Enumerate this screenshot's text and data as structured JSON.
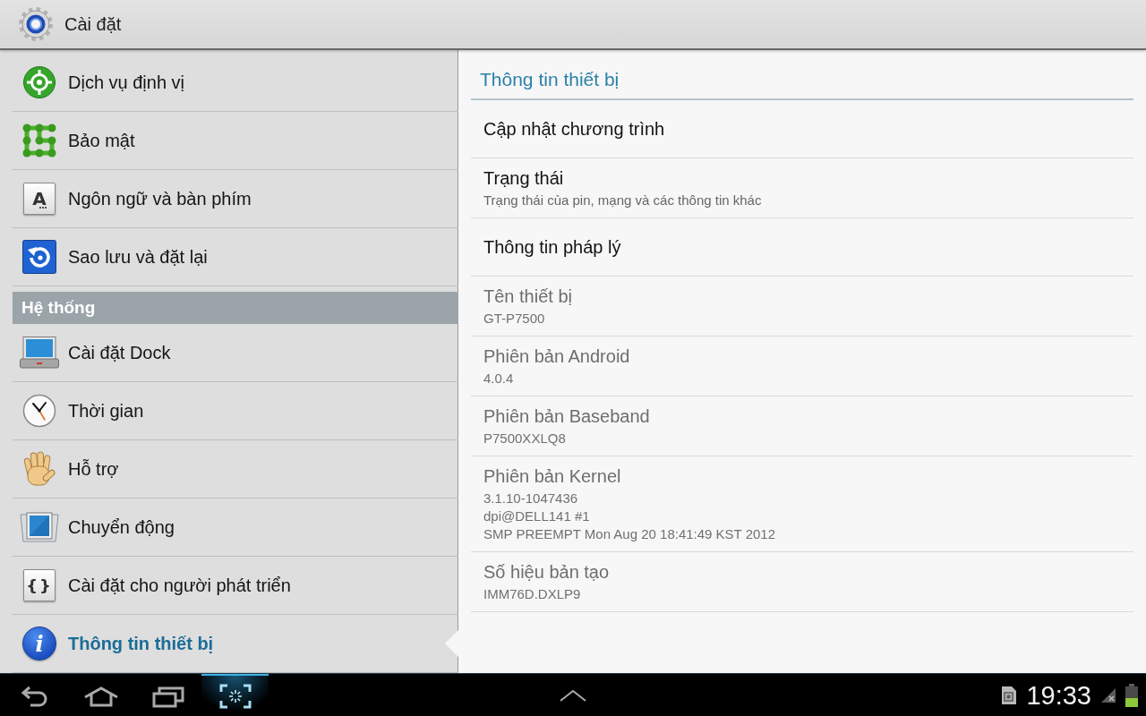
{
  "action_bar": {
    "title": "Cài đặt"
  },
  "sidebar": {
    "items": [
      {
        "kind": "setting",
        "label": "Dịch vụ định vị",
        "selected": false
      },
      {
        "kind": "setting",
        "label": "Bảo mật",
        "selected": false
      },
      {
        "kind": "setting",
        "label": "Ngôn ngữ và bàn phím",
        "selected": false,
        "icon_glyph": "A"
      },
      {
        "kind": "setting",
        "label": "Sao lưu và đặt lại",
        "selected": false
      },
      {
        "kind": "header",
        "label": "Hệ thống"
      },
      {
        "kind": "setting",
        "label": "Cài đặt Dock",
        "selected": false
      },
      {
        "kind": "setting",
        "label": "Thời gian",
        "selected": false
      },
      {
        "kind": "setting",
        "label": "Hỗ trợ",
        "selected": false
      },
      {
        "kind": "setting",
        "label": "Chuyển động",
        "selected": false
      },
      {
        "kind": "setting",
        "label": "Cài đặt cho người phát triển",
        "selected": false,
        "icon_glyph": "{}"
      },
      {
        "kind": "setting",
        "label": "Thông tin thiết bị",
        "selected": true,
        "icon_glyph": "i"
      }
    ]
  },
  "detail": {
    "title": "Thông tin thiết bị",
    "items": [
      {
        "title": "Cập nhật chương trình",
        "disabled": false
      },
      {
        "title": "Trạng thái",
        "summary": "Trạng thái của pin, mạng và các thông tin khác",
        "disabled": false
      },
      {
        "title": "Thông tin pháp lý",
        "disabled": false
      },
      {
        "title": "Tên thiết bị",
        "summary": "GT-P7500",
        "disabled": true
      },
      {
        "title": "Phiên bản Android",
        "summary": "4.0.4",
        "disabled": true
      },
      {
        "title": "Phiên bản Baseband",
        "summary": "P7500XXLQ8",
        "disabled": true
      },
      {
        "title": "Phiên bản Kernel",
        "summary": "3.1.10-1047436\ndpi@DELL141 #1\nSMP PREEMPT Mon Aug 20 18:41:49 KST 2012",
        "disabled": true
      },
      {
        "title": "Số hiệu bản tạo",
        "summary": "IMM76D.DXLP9",
        "disabled": true
      }
    ]
  },
  "nav_bar": {
    "buttons": [
      {
        "kind": "back",
        "highlighted": false
      },
      {
        "kind": "home",
        "highlighted": false
      },
      {
        "kind": "recent",
        "highlighted": false
      },
      {
        "kind": "screenshot",
        "highlighted": true
      }
    ],
    "clock": "19:33"
  }
}
